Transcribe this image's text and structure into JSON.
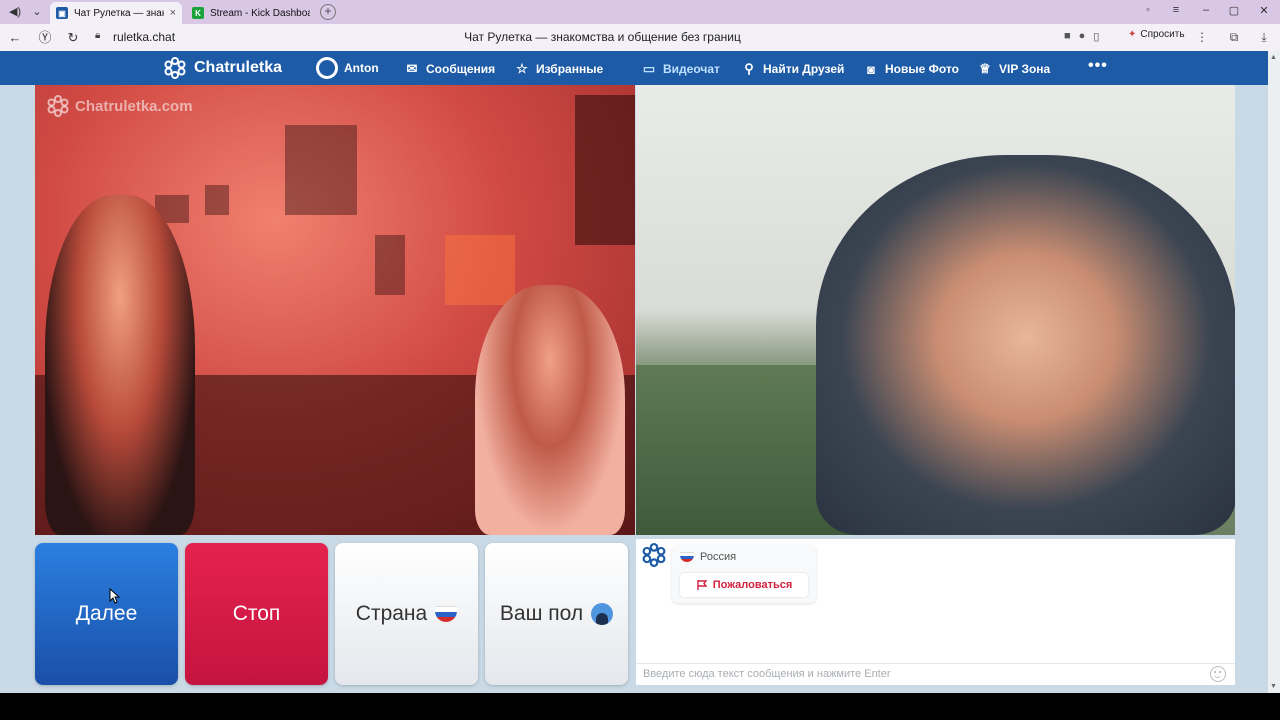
{
  "browser": {
    "tabs": [
      {
        "title": "Чат Рулетка — знак",
        "active": true
      },
      {
        "title": "Stream - Kick Dashboard",
        "active": false
      }
    ],
    "url": "ruletka.chat",
    "page_title": "Чат Рулетка — знакомства и общение без границ",
    "ask_label": "Спросить"
  },
  "site": {
    "brand": "Chatruletka",
    "nav": [
      {
        "label": "Anton",
        "icon": "user-avatar-icon"
      },
      {
        "label": "Сообщения",
        "icon": "envelope-icon"
      },
      {
        "label": "Избранные",
        "icon": "star-icon"
      },
      {
        "label": "Видеочат",
        "icon": "video-camera-icon",
        "active": true
      },
      {
        "label": "Найти Друзей",
        "icon": "search-icon"
      },
      {
        "label": "Новые Фото",
        "icon": "camera-icon"
      },
      {
        "label": "VIP Зона",
        "icon": "crown-icon"
      }
    ],
    "more": "•••",
    "watermark": "Chatruletka.com",
    "buttons": {
      "next": "Далее",
      "stop": "Стоп",
      "country": "Страна",
      "gender": "Ваш пол"
    },
    "chat": {
      "country": "Россия",
      "report": "Пожаловаться",
      "placeholder": "Введите сюда текст сообщения и нажмите Enter"
    }
  },
  "colors": {
    "nav": "#1e5ba7",
    "next_button": "#1f62c2",
    "stop_button": "#d81b47",
    "report_text": "#d3223f"
  }
}
